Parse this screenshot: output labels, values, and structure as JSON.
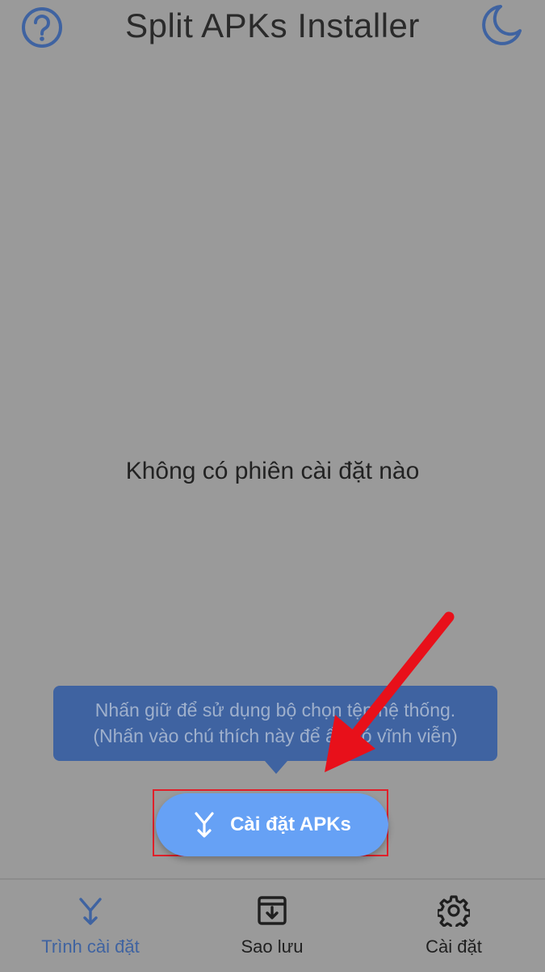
{
  "header": {
    "title": "Split APKs Installer",
    "help_icon": "help-circle-icon",
    "theme_icon": "moon-icon"
  },
  "main": {
    "empty_message": "Không có phiên cài đặt nào"
  },
  "tooltip": {
    "line1": "Nhấn giữ để sử dụng bộ chọn tệp hệ thống.",
    "line2": "(Nhấn vào chú thích này để ẩn nó vĩnh viễn)"
  },
  "install_button": {
    "label": "Cài đặt APKs",
    "icon": "merge-arrow-icon"
  },
  "annotation": {
    "arrow_color": "#e8101a",
    "highlight_color": "#e0202a"
  },
  "bottom_nav": {
    "items": [
      {
        "label": "Trình cài đặt",
        "icon": "merge-arrow-icon",
        "active": true
      },
      {
        "label": "Sao lưu",
        "icon": "archive-icon",
        "active": false
      },
      {
        "label": "Cài đặt",
        "icon": "gear-icon",
        "active": false
      }
    ]
  },
  "colors": {
    "accent": "#3f63a1",
    "button": "#66a1f5",
    "background": "#9a9a9a"
  }
}
